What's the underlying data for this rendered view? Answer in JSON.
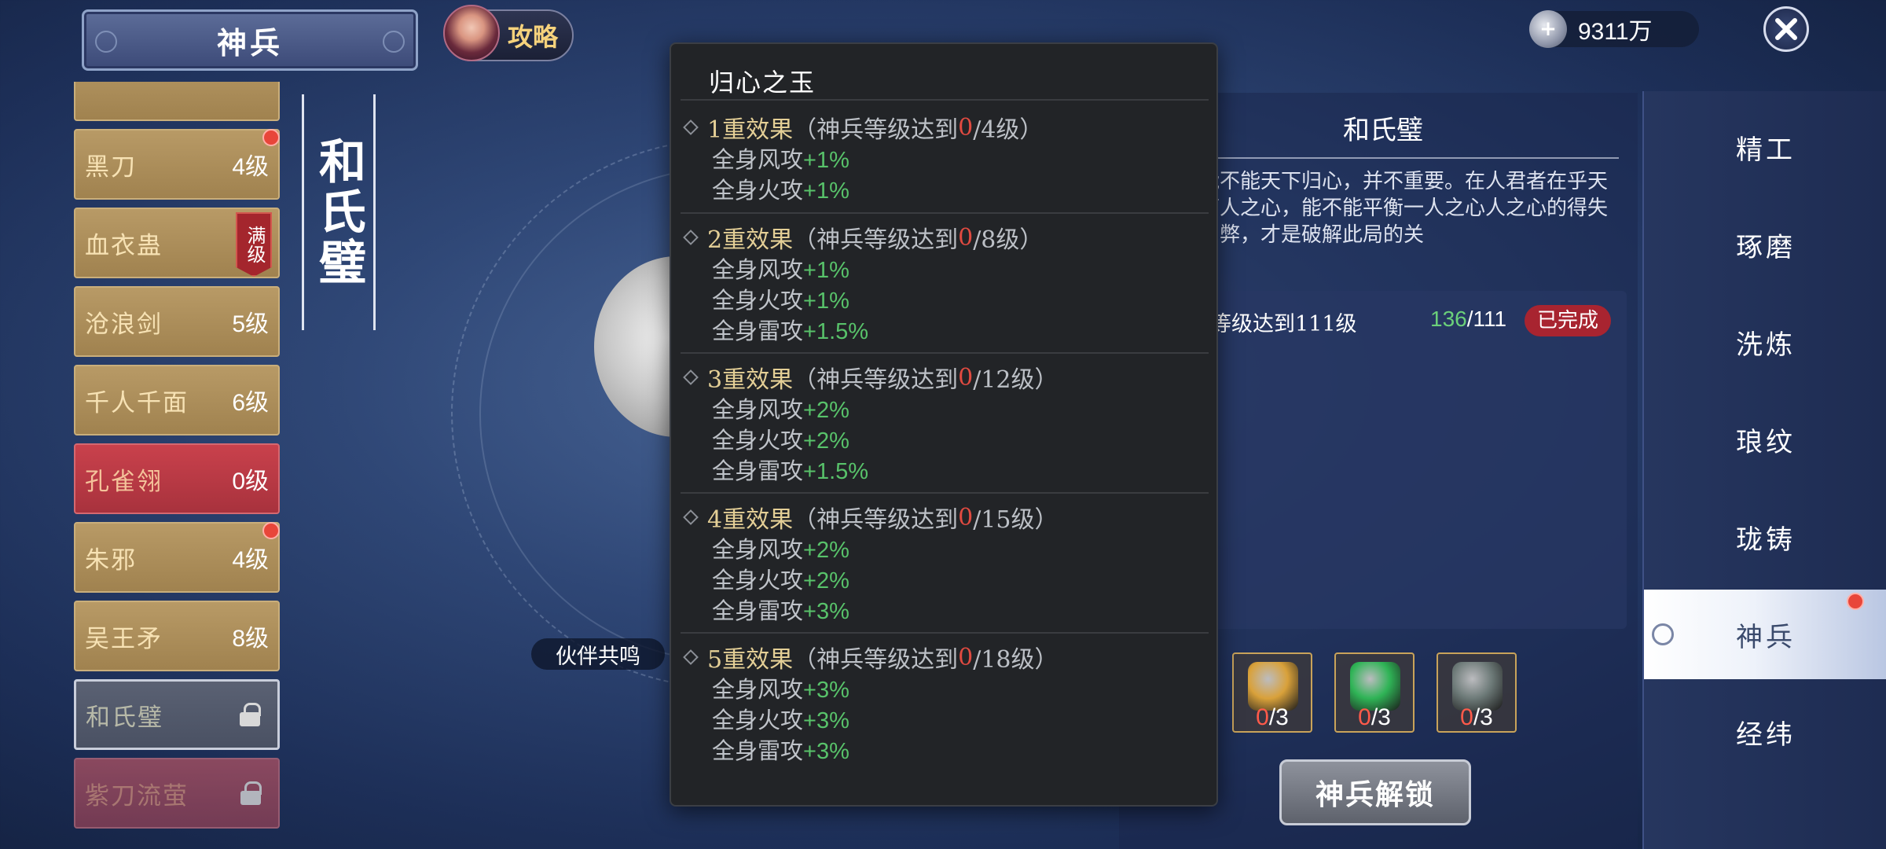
{
  "header": {
    "title": "神兵",
    "guide_label": "攻略"
  },
  "currency": {
    "amount": "9311万"
  },
  "weapons": [
    {
      "name": "",
      "level": "",
      "style": "gold"
    },
    {
      "name": "黑刀",
      "level": "4级",
      "style": "gold",
      "dot": true
    },
    {
      "name": "血衣蛊",
      "level": "",
      "style": "gold",
      "badge": "满级"
    },
    {
      "name": "沧浪剑",
      "level": "5级",
      "style": "gold"
    },
    {
      "name": "千人千面",
      "level": "6级",
      "style": "gold"
    },
    {
      "name": "孔雀翎",
      "level": "0级",
      "style": "red"
    },
    {
      "name": "朱邪",
      "level": "4级",
      "style": "gold",
      "dot": true
    },
    {
      "name": "吴王矛",
      "level": "8级",
      "style": "gold"
    },
    {
      "name": "和氏璧",
      "level": "",
      "style": "gray",
      "locked": true
    },
    {
      "name": "紫刀流萤",
      "level": "",
      "style": "dimred",
      "locked": true
    }
  ],
  "vertical_title": "和氏璧",
  "resonance_label": "伙伴共鸣",
  "popup": {
    "title": "归心之玉",
    "tiers": [
      {
        "name": "1重效果",
        "req_prefix": "（神兵等级达到",
        "current": "0",
        "req_suffix": "/4级）",
        "effects": [
          {
            "label": "全身风攻",
            "bonus": "+1%"
          },
          {
            "label": "全身火攻",
            "bonus": "+1%"
          }
        ]
      },
      {
        "name": "2重效果",
        "req_prefix": "（神兵等级达到",
        "current": "0",
        "req_suffix": "/8级）",
        "effects": [
          {
            "label": "全身风攻",
            "bonus": "+1%"
          },
          {
            "label": "全身火攻",
            "bonus": "+1%"
          },
          {
            "label": "全身雷攻",
            "bonus": "+1.5%"
          }
        ]
      },
      {
        "name": "3重效果",
        "req_prefix": "（神兵等级达到",
        "current": "0",
        "req_suffix": "/12级）",
        "effects": [
          {
            "label": "全身风攻",
            "bonus": "+2%"
          },
          {
            "label": "全身火攻",
            "bonus": "+2%"
          },
          {
            "label": "全身雷攻",
            "bonus": "+1.5%"
          }
        ]
      },
      {
        "name": "4重效果",
        "req_prefix": "（神兵等级达到",
        "current": "0",
        "req_suffix": "/15级）",
        "effects": [
          {
            "label": "全身风攻",
            "bonus": "+2%"
          },
          {
            "label": "全身火攻",
            "bonus": "+2%"
          },
          {
            "label": "全身雷攻",
            "bonus": "+3%"
          }
        ]
      },
      {
        "name": "5重效果",
        "req_prefix": "（神兵等级达到",
        "current": "0",
        "req_suffix": "/18级）",
        "effects": [
          {
            "label": "全身风攻",
            "bonus": "+3%"
          },
          {
            "label": "全身火攻",
            "bonus": "+3%"
          },
          {
            "label": "全身雷攻",
            "bonus": "+3%"
          }
        ]
      }
    ]
  },
  "info": {
    "title": "和氏璧",
    "description": "能不能天下归心，并不重要。在人君者在乎天下人之心，能不能平衡一人之心人之心的得失利弊，才是破解此局的关",
    "condition_text": "等级达到111级",
    "condition_current": "136",
    "condition_target": "/111",
    "condition_status": "已完成"
  },
  "materials": [
    {
      "current": "0",
      "total": "/3",
      "color": "#d9a13a"
    },
    {
      "current": "0",
      "total": "/3",
      "color": "#2fb456"
    },
    {
      "current": "0",
      "total": "/3",
      "color": "#6d7a78"
    }
  ],
  "unlock_button": "神兵解锁",
  "side_nav": [
    {
      "label": "精工"
    },
    {
      "label": "琢磨"
    },
    {
      "label": "洗炼"
    },
    {
      "label": "琅纹"
    },
    {
      "label": "珑铸"
    },
    {
      "label": "神兵",
      "active": true,
      "dot": true
    },
    {
      "label": "经纬"
    }
  ],
  "colors": {
    "bonus_green": "#58c26a",
    "requirement_red": "#e04a40",
    "tier_gold": "#e4cf96"
  }
}
